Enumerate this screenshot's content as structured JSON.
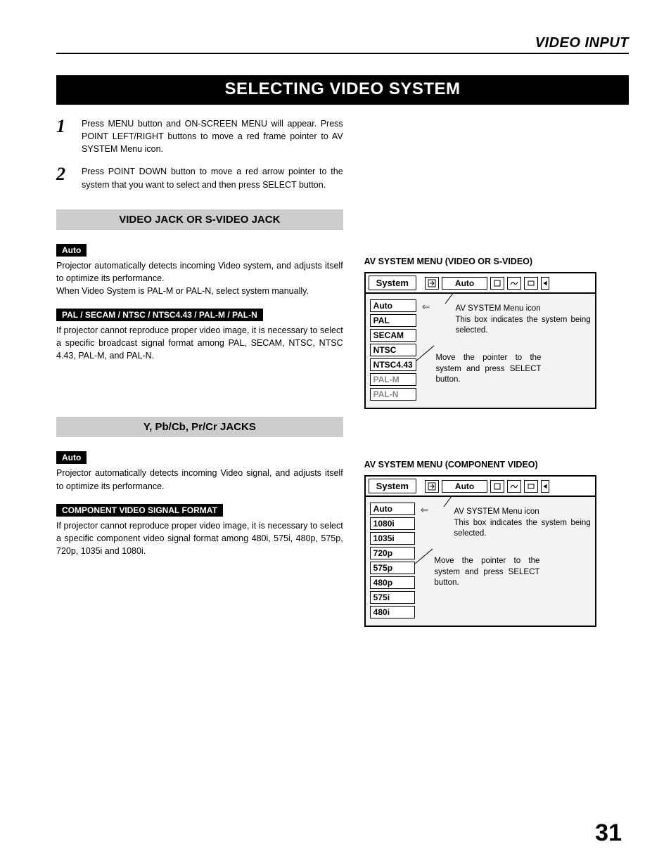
{
  "header": {
    "section": "VIDEO INPUT"
  },
  "title": "SELECTING VIDEO SYSTEM",
  "steps": [
    {
      "num": "1",
      "text": "Press MENU button and ON-SCREEN MENU will appear.  Press POINT LEFT/RIGHT buttons to move a red frame pointer to AV SYSTEM Menu icon."
    },
    {
      "num": "2",
      "text": "Press POINT DOWN button to move a red arrow pointer to the system that you want to select and then press SELECT button."
    }
  ],
  "sectionA": {
    "band": "VIDEO JACK OR S-VIDEO JACK",
    "pill1": "Auto",
    "text1": "Projector automatically detects incoming Video system, and adjusts itself to optimize its performance.\nWhen Video System is PAL-M or PAL-N, select system manually.",
    "pill2": "PAL / SECAM / NTSC / NTSC4.43 / PAL-M / PAL-N",
    "text2": "If projector cannot reproduce proper video image, it is necessary to select a specific broadcast signal format among PAL, SECAM, NTSC, NTSC 4.43, PAL-M, and PAL-N."
  },
  "sectionB": {
    "band": "Y, Pb/Cb, Pr/Cr JACKS",
    "pill1": "Auto",
    "text1": "Projector automatically detects incoming Video signal, and adjusts itself to optimize its performance.",
    "pill2": "COMPONENT VIDEO SIGNAL FORMAT",
    "text2": "If projector cannot reproduce proper video image, it is necessary to select a specific component video signal format among 480i, 575i, 480p, 575p, 720p, 1035i and 1080i."
  },
  "osdA": {
    "caption": "AV SYSTEM MENU (VIDEO OR S-VIDEO)",
    "system": "System",
    "selected": "Auto",
    "items": [
      {
        "label": "Auto",
        "dim": false
      },
      {
        "label": "PAL",
        "dim": false
      },
      {
        "label": "SECAM",
        "dim": false
      },
      {
        "label": "NTSC",
        "dim": false
      },
      {
        "label": "NTSC4.43",
        "dim": false
      },
      {
        "label": "PAL-M",
        "dim": true
      },
      {
        "label": "PAL-N",
        "dim": true
      }
    ],
    "annot1a": "AV SYSTEM Menu icon",
    "annot1b": "This box indicates the system being selected.",
    "annot2": "Move the pointer to the system and press SELECT button."
  },
  "osdB": {
    "caption": "AV SYSTEM MENU (COMPONENT VIDEO)",
    "system": "System",
    "selected": "Auto",
    "items": [
      {
        "label": "Auto",
        "dim": false
      },
      {
        "label": "1080i",
        "dim": false
      },
      {
        "label": "1035i",
        "dim": false
      },
      {
        "label": "720p",
        "dim": false
      },
      {
        "label": "575p",
        "dim": false
      },
      {
        "label": "480p",
        "dim": false
      },
      {
        "label": "575i",
        "dim": false
      },
      {
        "label": "480i",
        "dim": false
      }
    ],
    "annot1a": "AV SYSTEM Menu icon",
    "annot1b": "This box indicates the system being selected.",
    "annot2": "Move the pointer to the system and press SELECT button."
  },
  "page": "31"
}
